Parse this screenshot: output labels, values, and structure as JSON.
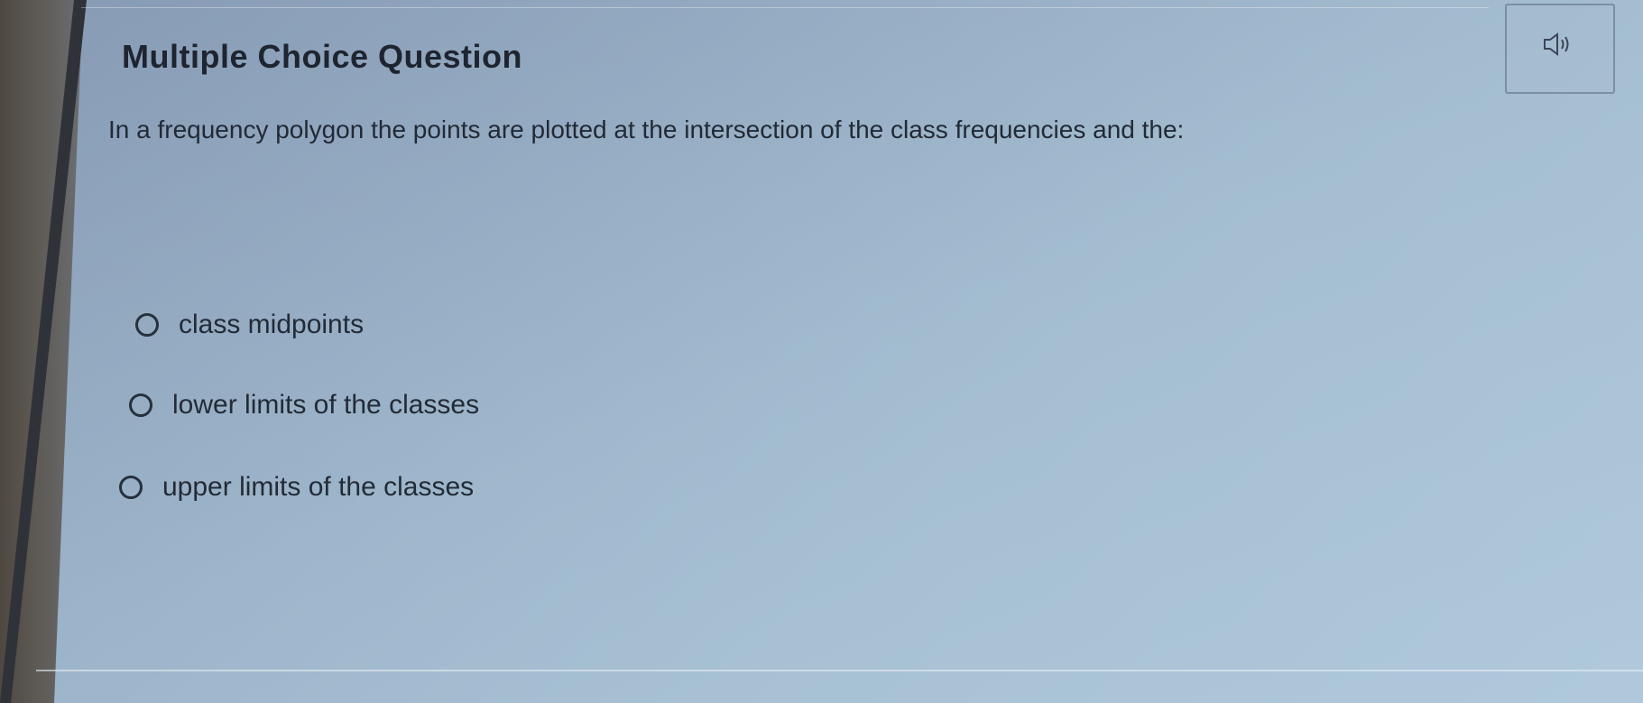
{
  "question": {
    "type_label": "Multiple Choice Question",
    "prompt": "In a frequency polygon the points are plotted at the intersection of the class frequencies and the:",
    "audio_icon": "speaker-icon",
    "options": [
      {
        "label": "class midpoints",
        "selected": false
      },
      {
        "label": "lower limits of the classes",
        "selected": false
      },
      {
        "label": "upper limits of the classes",
        "selected": false
      }
    ]
  },
  "colors": {
    "text": "#232b37",
    "radio_border": "#27303d"
  }
}
